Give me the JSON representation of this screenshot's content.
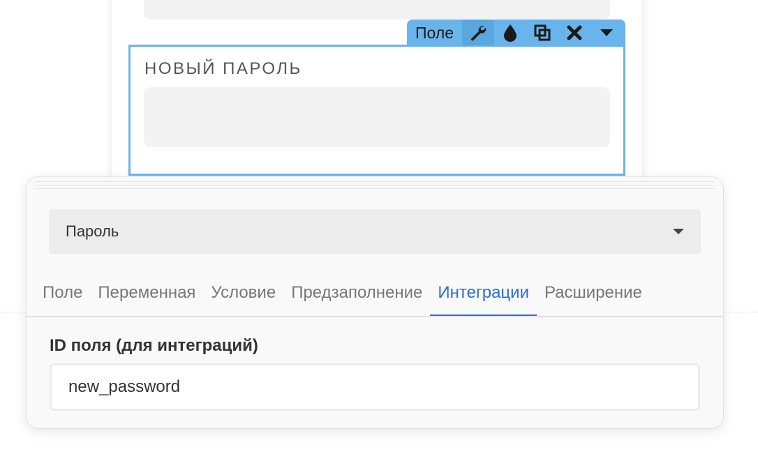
{
  "form": {
    "field_label": "НОВЫЙ ПАРОЛЬ"
  },
  "toolbar": {
    "label": "Поле",
    "buttons": [
      "wrench-icon",
      "drop-icon",
      "duplicate-icon",
      "close-icon",
      "caret-down-icon"
    ]
  },
  "settings": {
    "field_type": "Пароль",
    "tabs": [
      {
        "label": "Поле",
        "active": false
      },
      {
        "label": "Переменная",
        "active": false
      },
      {
        "label": "Условие",
        "active": false
      },
      {
        "label": "Предзаполнение",
        "active": false
      },
      {
        "label": "Интеграции",
        "active": true
      },
      {
        "label": "Расширение",
        "active": false
      }
    ],
    "id_label": "ID поля (для интеграций)",
    "id_value": "new_password"
  },
  "colors": {
    "selection_blue": "#6ab4ec",
    "active_tab": "#2a6fdb"
  }
}
